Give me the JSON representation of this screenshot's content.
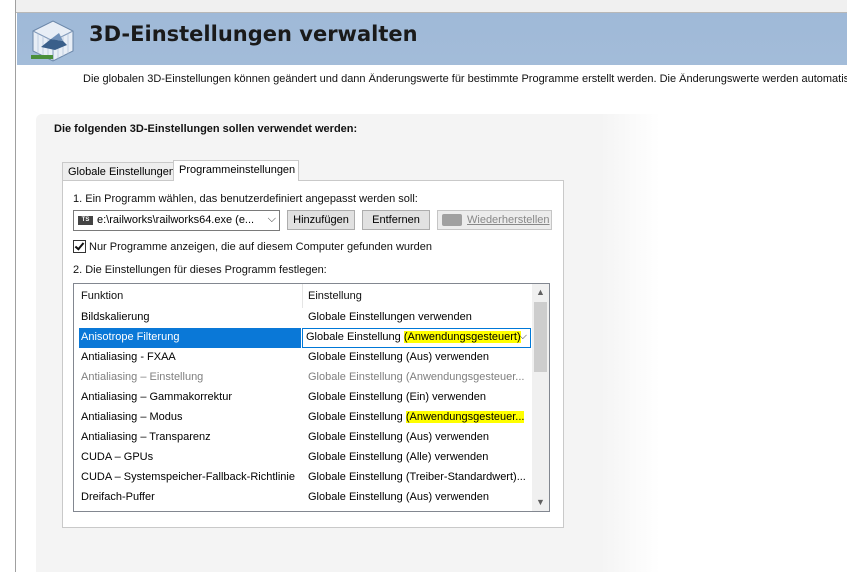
{
  "header": {
    "title": "3D-Einstellungen verwalten",
    "description": "Die globalen 3D-Einstellungen können geändert und dann Änderungswerte für bestimmte Programme erstellt werden. Die Änderungswerte werden automatisch bei"
  },
  "panel": {
    "heading": "Die folgenden 3D-Einstellungen sollen verwendet werden:"
  },
  "tabs": [
    {
      "label": "Globale Einstellungen"
    },
    {
      "label": "Programmeinstellungen"
    }
  ],
  "step1": {
    "label": "1. Ein Programm wählen, das benutzerdefiniert angepasst werden soll:",
    "program_icon": "TS",
    "program_value": "e:\\railworks\\railworks64.exe (e...",
    "add_label": "Hinzufügen",
    "remove_label": "Entfernen",
    "restore_label": "Wiederherstellen"
  },
  "filter": {
    "label": "Nur Programme anzeigen, die auf diesem Computer gefunden wurden",
    "checked": true
  },
  "step2": {
    "label": "2. Die Einstellungen für dieses Programm festlegen:"
  },
  "grid": {
    "col_function": "Funktion",
    "col_setting": "Einstellung",
    "rows": [
      {
        "fn": "Bildskalierung",
        "val": "Globale Einstellungen verwenden"
      },
      {
        "fn": "Anisotrope Filterung",
        "val_prefix": "Globale Einstellung ",
        "val_highlight": "(Anwendungsgesteuert)"
      },
      {
        "fn": "Antialiasing - FXAA",
        "val": "Globale Einstellung (Aus) verwenden"
      },
      {
        "fn": "Antialiasing – Einstellung",
        "val": "Globale Einstellung (Anwendungsgesteuer..."
      },
      {
        "fn": "Antialiasing – Gammakorrektur",
        "val": "Globale Einstellung (Ein) verwenden"
      },
      {
        "fn": "Antialiasing – Modus",
        "val_prefix": "Globale Einstellung ",
        "val_highlight": "(Anwendungsgesteuer..."
      },
      {
        "fn": "Antialiasing – Transparenz",
        "val": "Globale Einstellung (Aus) verwenden"
      },
      {
        "fn": "CUDA – GPUs",
        "val": "Globale Einstellung (Alle) verwenden"
      },
      {
        "fn": "CUDA – Systemspeicher-Fallback-Richtlinie",
        "val": "Globale Einstellung (Treiber-Standardwert)..."
      },
      {
        "fn": "Dreifach-Puffer",
        "val": "Globale Einstellung (Aus) verwenden"
      }
    ]
  },
  "colors": {
    "header_bg": "#a3bcd9",
    "selection": "#0a78d7",
    "highlight": "#ffff00"
  }
}
